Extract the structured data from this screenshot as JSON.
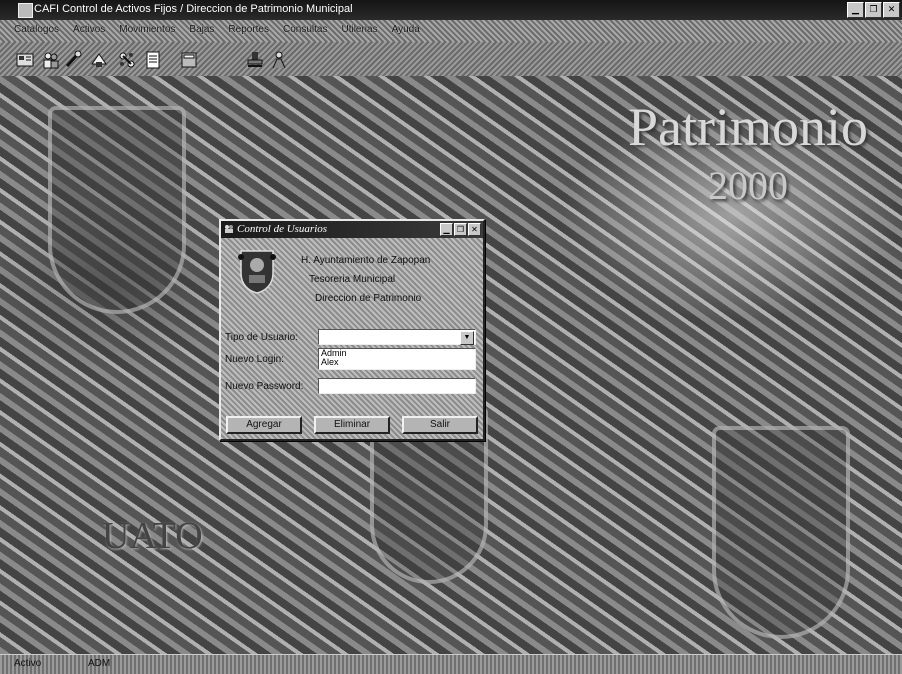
{
  "window": {
    "title": "CAFI Control de Activos Fijos / Direccion de Patrimonio Municipal",
    "controls": [
      "minimize",
      "restore",
      "close"
    ]
  },
  "menu": {
    "items": [
      "Catalogos",
      "Activos",
      "Movimientos",
      "Bajas",
      "Reportes",
      "Consultas",
      "Utilerias",
      "Ayuda"
    ]
  },
  "toolbar": {
    "icons": [
      "inventory-icon",
      "users-icon",
      "tools-icon",
      "transfer-icon",
      "links-icon",
      "document-icon",
      "calculator-icon",
      "stamp-icon",
      "person-icon"
    ]
  },
  "background": {
    "title": "Patrimonio",
    "year": "2000",
    "city": "UATO"
  },
  "dialog": {
    "title": "Control de Usuarios",
    "org_lines": [
      "H. Ayuntamiento de Zapopan",
      "Tesoreria Municipal",
      "Direccion de Patrimonio"
    ],
    "fields": {
      "user_type_label": "Tipo de Usuario:",
      "user_type_value": "",
      "login_label": "Nuevo Login:",
      "login_options": [
        "Admin",
        "Alex"
      ],
      "password_label": "Nuevo Password:",
      "password_value": ""
    },
    "buttons": [
      "Agregar",
      "Eliminar",
      "Salir"
    ]
  },
  "status": {
    "left": "Activo",
    "right": "ADM"
  }
}
